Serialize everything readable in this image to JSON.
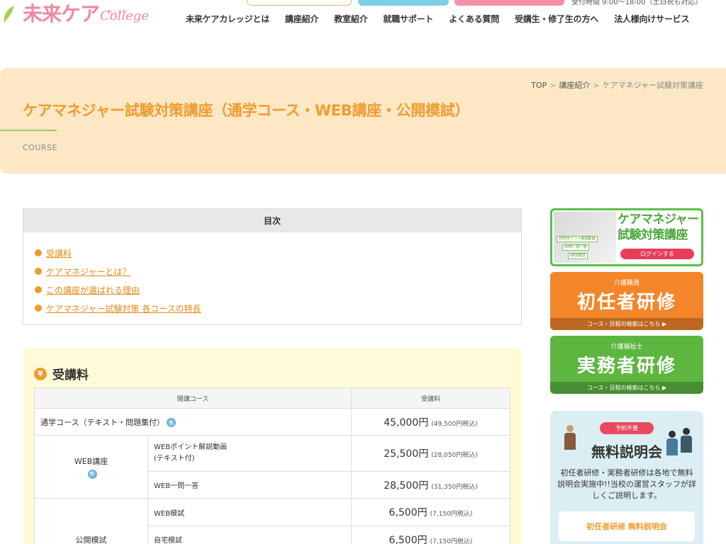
{
  "header": {
    "logo_main": "未来ケア",
    "logo_college": "College",
    "logo_ruby": "カレッジ",
    "hours": "受付時間 9:00～18:00（土日祝も対応）",
    "nav": [
      "未来ケアカレッジとは",
      "講座紹介",
      "教室紹介",
      "就職サポート",
      "よくある質問",
      "受講生・修了生の方へ",
      "法人様向けサービス"
    ]
  },
  "breadcrumb": {
    "top": "TOP",
    "sep": ">",
    "parent": "講座紹介",
    "current": "ケアマネジャー試験対策講座"
  },
  "page": {
    "title": "ケアマネジャー試験対策講座（通学コース・WEB講座・公開模試）",
    "sub_label": "COURSE"
  },
  "toc": {
    "heading": "目次",
    "items": [
      "受講料",
      "ケアマネジャーとは？",
      "この講座が選ばれる理由",
      "ケアマネジャー試験対策 各コースの特長"
    ]
  },
  "fee": {
    "heading": "受講料",
    "yen_glyph": "¥",
    "col_course": "開講コース",
    "col_fee": "受講料",
    "badge": "教",
    "rows": [
      {
        "group": "通学コース（テキスト・問題集付）",
        "item": "",
        "price": "45,000円",
        "tax": "(49,500円税込)"
      },
      {
        "group": "WEB講座",
        "item": "WEBポイント解説動画",
        "item2": "(テキスト付)",
        "price": "25,500円",
        "tax": "(28,050円税込)"
      },
      {
        "group": "",
        "item": "WEB一問一答",
        "price": "28,500円",
        "tax": "(31,350円税込)"
      },
      {
        "group": "公開模試",
        "item": "WEB模試",
        "price": "6,500円",
        "tax": "(7,150円税込)"
      },
      {
        "group": "",
        "item": "自宅模試",
        "price": "6,500円",
        "tax": "(7,150円税込)"
      }
    ]
  },
  "sidebar": {
    "caremane": {
      "title_line1": "ケアマネジャー",
      "title_line2": "試験対策講座",
      "tags": [
        "WEBポイント解説動画",
        "WEB一問一答",
        "WEB模試"
      ],
      "login": "ログインする"
    },
    "shoninsha": {
      "small": "介護職員",
      "big": "初任者研修",
      "bar": "コース・日程の検索はこちら ▶"
    },
    "jitsumusha": {
      "small": "介護福祉士",
      "big": "実務者研修",
      "bar": "コース・日程の検索はこちら ▶"
    },
    "setsumeikai": {
      "pill": "予約不要",
      "head": "無料説明会",
      "desc": "初任者研修・実務者研修は各地で無料説明会実施中!!当校の運営スタッフが詳しくご説明します。",
      "button": "初任者研修 無料説明会"
    }
  },
  "colors": {
    "accent": "#f29a2e",
    "band": "#fde8c6",
    "green": "#5db640",
    "orange": "#f3862a",
    "pink": "#ef8aa0"
  }
}
